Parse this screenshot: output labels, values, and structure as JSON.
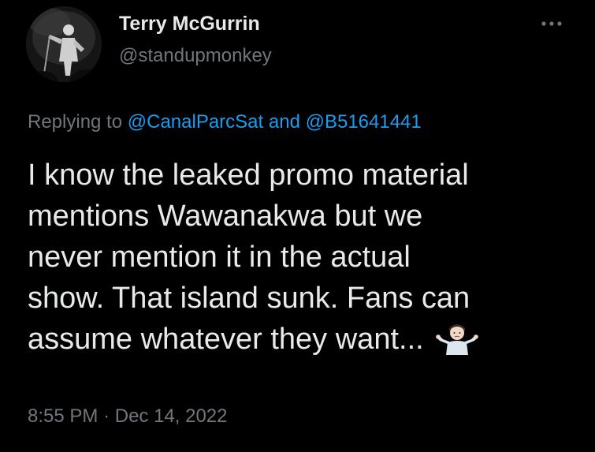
{
  "author": {
    "name": "Terry McGurrin",
    "handle": "@standupmonkey"
  },
  "icons": {
    "more": "more-horizontal-icon",
    "emoji": "man-shrugging-emoji"
  },
  "reply": {
    "prefix": "Replying to",
    "mention1": "@CanalParcSat",
    "conjunction": "and",
    "mention2": "@B51641441"
  },
  "tweet": {
    "lines": [
      "I know the leaked promo material",
      "mentions Wawanakwa but we",
      "never mention it in the actual",
      "show. That island sunk. Fans can",
      "assume whatever they want..."
    ]
  },
  "meta": {
    "time": "8:55 PM",
    "separator": "·",
    "date": "Dec 14, 2022"
  },
  "colors": {
    "background": "#000000",
    "text": "#e7e9ea",
    "secondary": "#71767b",
    "link": "#1d9bf0"
  }
}
